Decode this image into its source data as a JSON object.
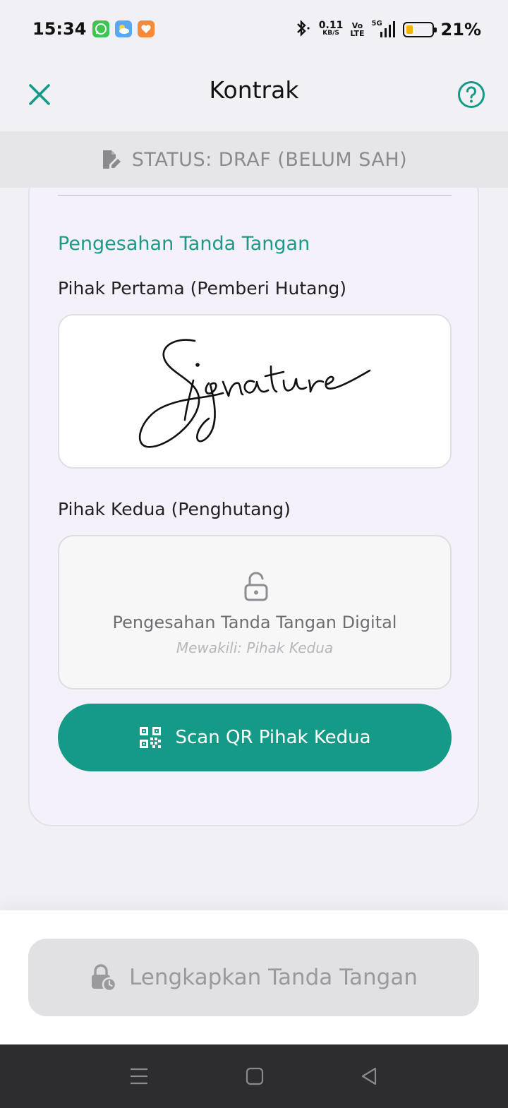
{
  "status_bar": {
    "time": "15:34",
    "speed_value": "0.11",
    "speed_unit": "KB/S",
    "volte_top": "Vo",
    "volte_bottom": "LTE",
    "network": "5G",
    "battery_percent": "21%",
    "battery_level": 0.21,
    "apps": [
      {
        "icon": "whatsapp-icon",
        "color": "#3ec453"
      },
      {
        "icon": "weather-icon",
        "color": "#5aa9f0"
      },
      {
        "icon": "heart-app-icon",
        "color": "#f48a3a"
      }
    ]
  },
  "header": {
    "title": "Kontrak",
    "close_icon": "close-icon",
    "help_icon": "help-icon"
  },
  "status_strip": {
    "text": "STATUS: DRAF (BELUM SAH)",
    "icon": "document-edit-icon"
  },
  "signature_section": {
    "title": "Pengesahan Tanda Tangan",
    "first_party_label": "Pihak Pertama (Pemberi Hutang)",
    "second_party_label": "Pihak Kedua (Penghutang)",
    "pending_title": "Pengesahan Tanda Tangan Digital",
    "pending_subtitle": "Mewakili: Pihak Kedua",
    "scan_button_label": "Scan QR Pihak Kedua"
  },
  "footer": {
    "complete_button_label": "Lengkapkan Tanda Tangan"
  },
  "colors": {
    "accent": "#169a88",
    "accent_text": "#1d9a87",
    "disabled_bg": "#e1e1e3",
    "disabled_text": "#9a9a9e"
  }
}
